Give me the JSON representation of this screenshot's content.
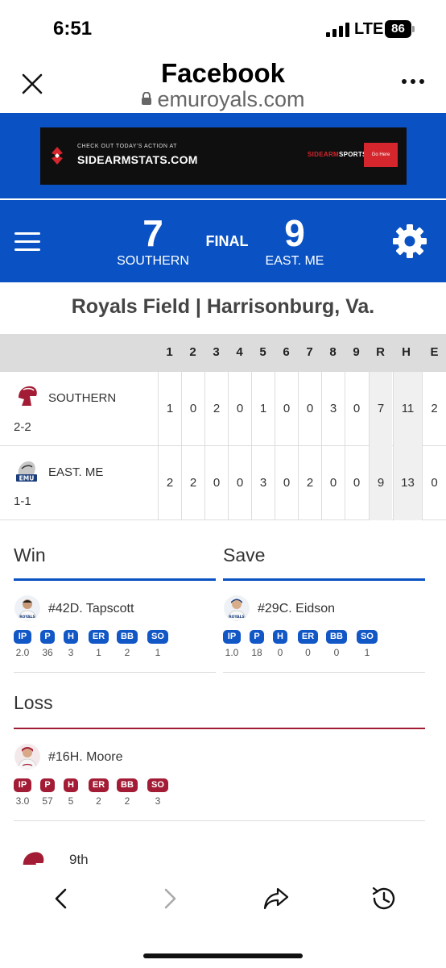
{
  "status_bar": {
    "time": "6:51",
    "network": "LTE",
    "battery": "86"
  },
  "browser": {
    "title": "Facebook",
    "url": "emuroyals.com"
  },
  "ad": {
    "tagline": "CHECK OUT TODAY'S ACTION AT",
    "site": "SIDEARMSTATS.COM",
    "brand_prefix": "SIDEARM",
    "brand_suffix": "SPORTS",
    "button": "Go Here"
  },
  "score": {
    "away": {
      "score": "7",
      "name": "SOUTHERN"
    },
    "home": {
      "score": "9",
      "name": "EAST. ME"
    },
    "status": "FINAL"
  },
  "venue": "Royals Field | Harrisonburg, Va.",
  "linescore": {
    "headers": [
      "1",
      "2",
      "3",
      "4",
      "5",
      "6",
      "7",
      "8",
      "9",
      "R",
      "H",
      "E"
    ],
    "teams": [
      {
        "name": "SOUTHERN",
        "record": "2-2",
        "values": [
          "1",
          "0",
          "2",
          "0",
          "1",
          "0",
          "0",
          "3",
          "0",
          "7",
          "11",
          "2"
        ]
      },
      {
        "name": "EAST. ME",
        "record": "1-1",
        "values": [
          "2",
          "2",
          "0",
          "0",
          "3",
          "0",
          "2",
          "0",
          "0",
          "9",
          "13",
          "0"
        ]
      }
    ]
  },
  "stat_labels": [
    "IP",
    "P",
    "H",
    "ER",
    "BB",
    "SO"
  ],
  "decisions": {
    "win": {
      "label": "Win",
      "pitcher": "#42D. Tapscott",
      "stats": [
        "2.0",
        "36",
        "3",
        "1",
        "2",
        "1"
      ]
    },
    "save": {
      "label": "Save",
      "pitcher": "#29C. Eidson",
      "stats": [
        "1.0",
        "18",
        "0",
        "0",
        "0",
        "1"
      ]
    },
    "loss": {
      "label": "Loss",
      "pitcher": "#16H. Moore",
      "stats": [
        "3.0",
        "57",
        "5",
        "2",
        "2",
        "3"
      ]
    }
  },
  "next_item": {
    "label": "9th"
  },
  "colors": {
    "royal_blue": "#0a52c3",
    "loss_red": "#a31c35",
    "badge_blue": "#1257c6"
  },
  "icons": [
    "close-icon",
    "lock-icon",
    "more-icon",
    "hamburger-icon",
    "gear-icon",
    "back-icon",
    "forward-icon",
    "share-icon",
    "history-icon"
  ]
}
